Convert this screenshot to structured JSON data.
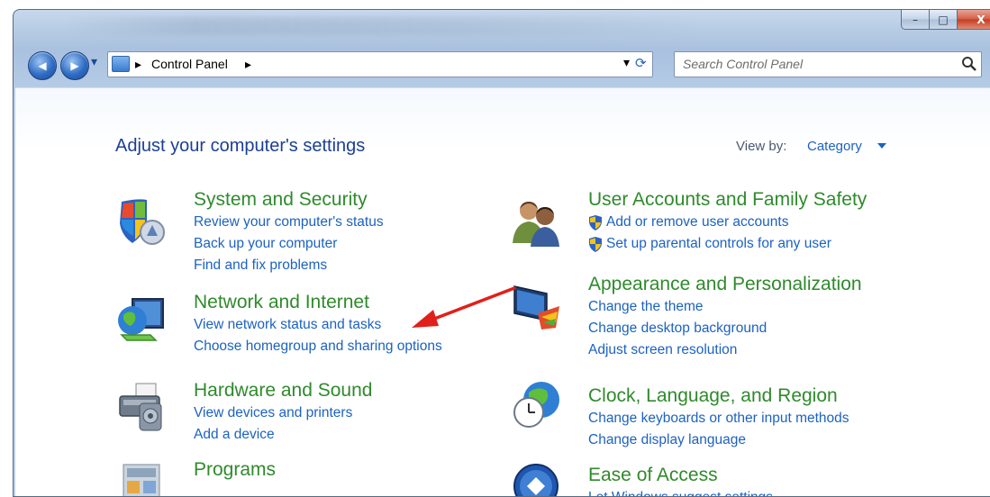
{
  "window": {
    "minimize_label": "–",
    "maximize_label": "□",
    "close_label": "X"
  },
  "nav": {
    "back_glyph": "◀",
    "forward_glyph": "▶",
    "history_glyph": "▾",
    "breadcrumb_sep": "▸",
    "breadcrumb_root": "Control Panel",
    "breadcrumb_next": "▸",
    "address_dropdown": "▾",
    "refresh_glyph": "⟳",
    "search_placeholder": "Search Control Panel"
  },
  "main": {
    "heading": "Adjust your computer's settings",
    "view_by_label": "View by:",
    "view_by_value": "Category",
    "left_categories": [
      {
        "icon": "shield-windows-icon",
        "title": "System and Security",
        "links": [
          "Review your computer's status",
          "Back up your computer",
          "Find and fix problems"
        ]
      },
      {
        "icon": "network-globe-icon",
        "title": "Network and Internet",
        "links": [
          "View network status and tasks",
          "Choose homegroup and sharing options"
        ]
      },
      {
        "icon": "printer-speaker-icon",
        "title": "Hardware and Sound",
        "links": [
          "View devices and printers",
          "Add a device"
        ]
      },
      {
        "icon": "programs-icon",
        "title": "Programs",
        "links": []
      }
    ],
    "right_categories": [
      {
        "icon": "users-icon",
        "title": "User Accounts and Family Safety",
        "links": [
          "Add or remove user accounts",
          "Set up parental controls for any user"
        ]
      },
      {
        "icon": "monitor-palette-icon",
        "title": "Appearance and Personalization",
        "links": [
          "Change the theme",
          "Change desktop background",
          "Adjust screen resolution"
        ]
      },
      {
        "icon": "clock-globe-icon",
        "title": "Clock, Language, and Region",
        "links": [
          "Change keyboards or other input methods",
          "Change display language"
        ]
      },
      {
        "icon": "ease-of-access-icon",
        "title": "Ease of Access",
        "links": [
          "Let Windows suggest settings"
        ]
      }
    ]
  },
  "annotation": {
    "arrow_color": "#e0201b"
  }
}
